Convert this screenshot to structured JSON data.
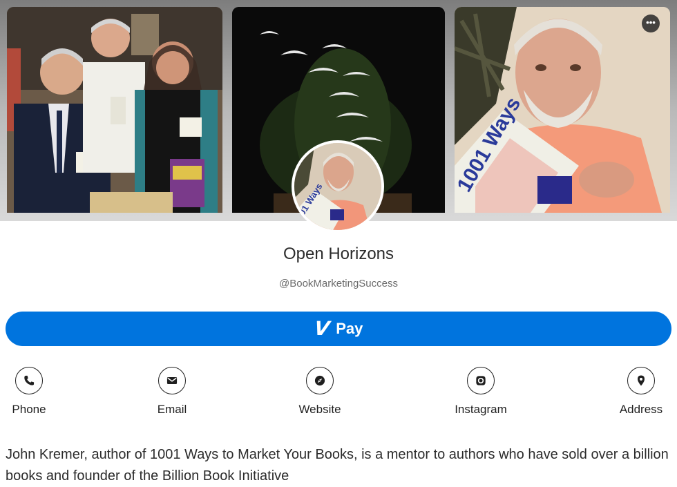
{
  "cover": {
    "photos": [
      "event-group-photo",
      "birds-sculpture-photo",
      "author-holding-book-photo"
    ],
    "more_icon": "more-horizontal-icon",
    "more_label": "•••"
  },
  "profile": {
    "name": "Open Horizons",
    "handle": "@BookMarketingSuccess",
    "avatar": "author-avatar"
  },
  "pay": {
    "label": "Pay",
    "icon_glyph": "V",
    "icon": "venmo-icon",
    "color": "#0074de"
  },
  "contacts": [
    {
      "label": "Phone",
      "icon": "phone-icon"
    },
    {
      "label": "Email",
      "icon": "email-icon"
    },
    {
      "label": "Website",
      "icon": "compass-icon"
    },
    {
      "label": "Instagram",
      "icon": "instagram-icon"
    },
    {
      "label": "Address",
      "icon": "map-pin-icon"
    }
  ],
  "bio": "John Kremer, author of 1001 Ways to Market Your Books, is a mentor to authors who have sold over a billion books and founder of the Billion Book Initiative"
}
